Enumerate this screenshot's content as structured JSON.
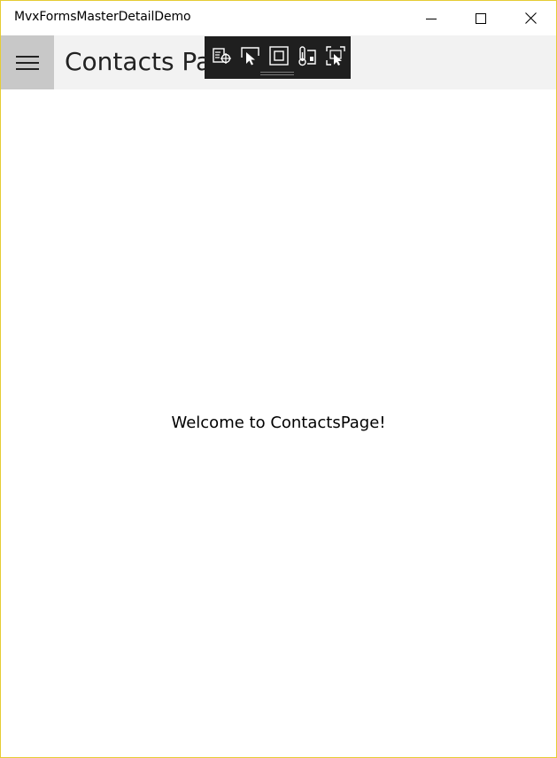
{
  "window": {
    "title": "MvxFormsMasterDetailDemo",
    "buttons": [
      "minimize-icon",
      "maximize-icon",
      "close-icon"
    ],
    "border_color": "#e6cc33"
  },
  "header": {
    "menu_icon": "hamburger-icon",
    "title": "Contacts Page",
    "background": "#f2f2f2",
    "menu_background": "#c8c8c8"
  },
  "debug_toolbar": {
    "icons": [
      "live-visual-tree-icon",
      "select-element-icon",
      "display-layout-adorners-icon",
      "track-focus-icon",
      "preview-selection-icon"
    ],
    "background": "#1f1f1f"
  },
  "content": {
    "welcome_text": "Welcome to ContactsPage!"
  }
}
